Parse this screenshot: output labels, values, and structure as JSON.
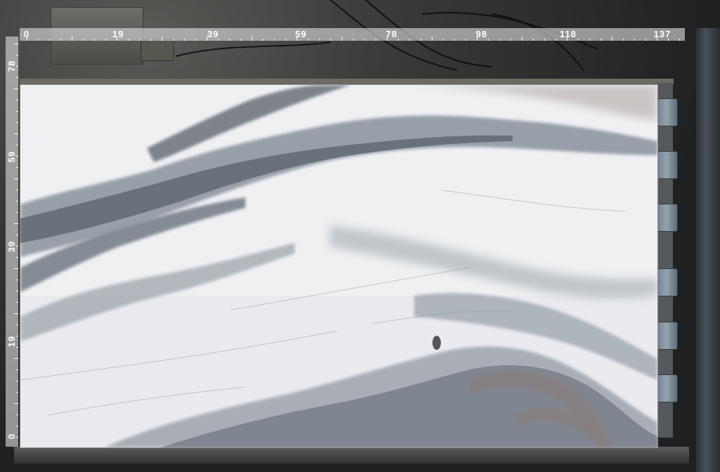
{
  "image": {
    "subject": "marble-slab",
    "colors": {
      "slab_base": "#eef0f2",
      "vein_dark": "#5e6670",
      "vein_mid": "#8a929c",
      "vein_light": "#b3b9c0",
      "vein_warm": "#8c7b78",
      "ruler_bg": "#dcdcdc",
      "ruler_text": "#ffffff",
      "background": "#1e1f21"
    }
  },
  "ruler": {
    "top_labels": [
      "0",
      "19",
      "39",
      "59",
      "78",
      "98",
      "118",
      "137"
    ],
    "left_labels": [
      "78",
      "59",
      "39",
      "19",
      "0"
    ]
  }
}
